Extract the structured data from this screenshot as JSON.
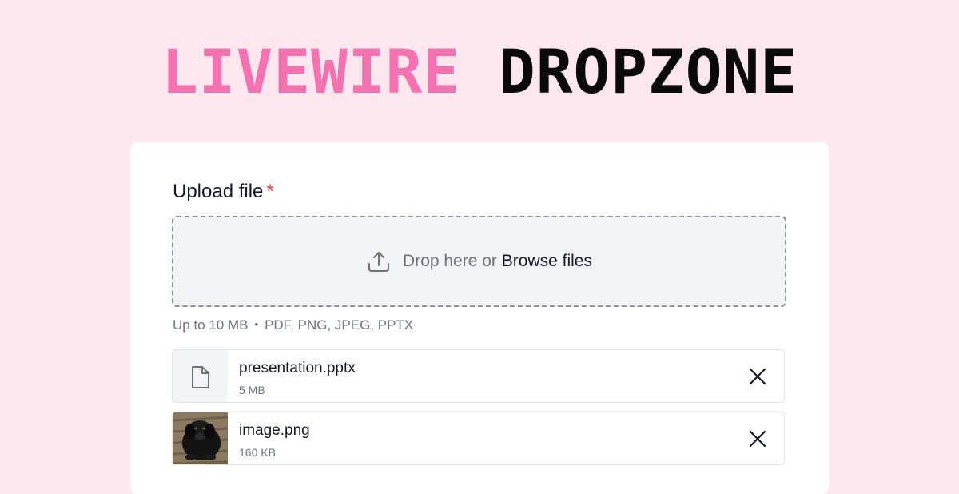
{
  "title": {
    "part1": "LIVEWIRE",
    "part2": "DROPZONE"
  },
  "colors": {
    "background": "#fde7ef",
    "accent_pink": "#f472b0",
    "required_red": "#ef4444",
    "muted_text": "#6b7280",
    "dropzone_bg": "#f3f4f6"
  },
  "form": {
    "label": "Upload file",
    "required_mark": "*",
    "dropzone": {
      "icon": "upload-icon",
      "text": "Drop here or",
      "browse_label": "Browse files"
    },
    "hint": {
      "limit": "Up to 10 MB",
      "separator": "•",
      "types": "PDF, PNG, JPEG, PPTX"
    }
  },
  "files": [
    {
      "name": "presentation.pptx",
      "size": "5 MB",
      "thumbnail": "file-icon",
      "remove_icon": "close-icon"
    },
    {
      "name": "image.png",
      "size": "160 KB",
      "thumbnail": "image-thumbnail",
      "remove_icon": "close-icon"
    }
  ]
}
